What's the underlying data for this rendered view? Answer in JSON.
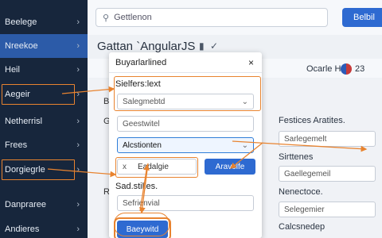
{
  "sidebar": {
    "items": [
      {
        "label": "Beelege"
      },
      {
        "label": "Nreekoe"
      },
      {
        "label": "Heil"
      },
      {
        "label": "Aegeir"
      },
      {
        "label": "Netherrisl"
      },
      {
        "label": "Frees"
      },
      {
        "label": "Dorgiegrle"
      },
      {
        "label": "Danpraree"
      },
      {
        "label": "Andieres"
      }
    ]
  },
  "topbar": {
    "search_placeholder": "Gettlenon",
    "button_label": "Belbil"
  },
  "page": {
    "title": "Gattan `AngularJS",
    "status_text": "Ocarle H",
    "status_number": "23"
  },
  "background": {
    "letters": [
      "B",
      "G",
      "R"
    ],
    "right_labels": [
      "Festices Aratites.",
      "Sirttenes",
      "Nenectoce.",
      "Calcsnedep"
    ],
    "right_inputs": [
      "Sarlegemelt",
      "Gaellegemeil",
      "Selegemier"
    ]
  },
  "modal": {
    "title": "Buyarlarlined",
    "close": "×",
    "label1": "Sielfers:lext",
    "input1": "Salegmebtd",
    "input2": "Geestwitel",
    "select_value": "Alcstionten",
    "chip_x": "x",
    "chip_text": "Eadalgie",
    "chip_button": "Aravolfe",
    "label2": "Sad.stilles.",
    "input3": "Sefrienvial",
    "submit": "Baeywitd"
  }
}
